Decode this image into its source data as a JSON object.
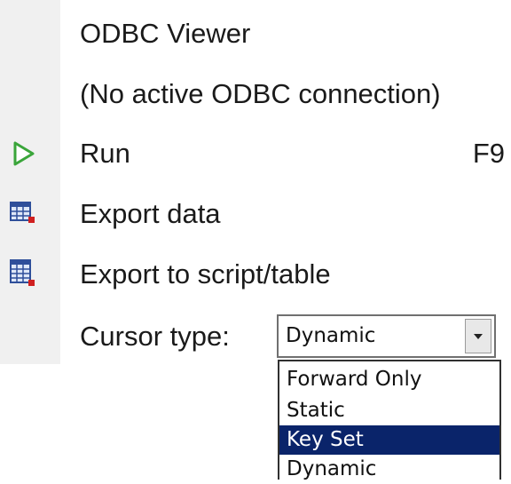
{
  "menu": {
    "title": "ODBC Viewer",
    "status": "(No active ODBC connection)",
    "run_label": "Run",
    "run_shortcut": "F9",
    "export_data_label": "Export data",
    "export_script_label": "Export to script/table",
    "cursor_label": "Cursor type:",
    "icons": {
      "run": "play-icon",
      "export_data": "table-export-icon",
      "export_script": "script-export-icon"
    },
    "colors": {
      "run_icon": "#3aa53a",
      "export_icon_grid": "#2f4f9a",
      "export_icon_badge": "#d02020",
      "selection": "#0a246a"
    }
  },
  "cursor_combo": {
    "value": "Dynamic",
    "options": [
      "Forward Only",
      "Static",
      "Key Set",
      "Dynamic"
    ],
    "highlighted": "Key Set"
  }
}
